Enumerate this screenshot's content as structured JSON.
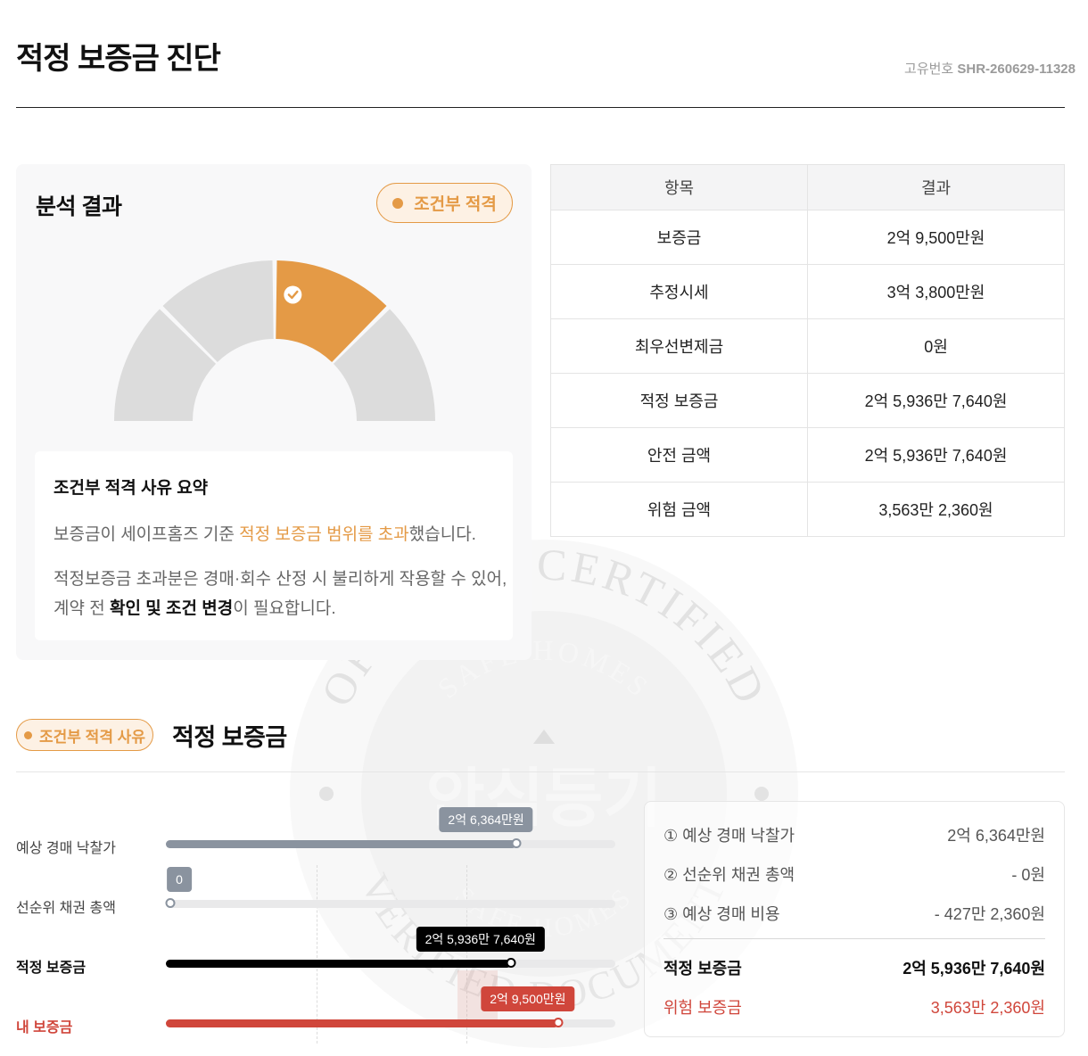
{
  "header": {
    "title": "적정 보증금 진단",
    "id_label": "고유번호",
    "id_value": "SHR-260629-11328"
  },
  "result": {
    "title": "분석 결과",
    "status": "조건부 적격",
    "gauge": {
      "segments": 4,
      "active_segment": 3,
      "active_color": "#E49A46",
      "inactive_color": "#DCDCDC"
    },
    "summary": {
      "title": "조건부 적격 사유 요약",
      "line1_a": "보증금이 세이프홈즈 기준 ",
      "line1_hl": "적정 보증금 범위를 초과",
      "line1_b": "했습니다.",
      "line2": "적정보증금 초과분은 경매·회수 산정 시 불리하게 작용할 수 있어,",
      "line3_a": "계약 전 ",
      "line3_strong": "확인 및 조건 변경",
      "line3_b": "이 필요합니다."
    }
  },
  "table": {
    "headers": [
      "항목",
      "결과"
    ],
    "rows": [
      [
        "보증금",
        "2억 9,500만원"
      ],
      [
        "추정시세",
        "3억 3,800만원"
      ],
      [
        "최우선변제금",
        "0원"
      ],
      [
        "적정 보증금",
        "2억 5,936만 7,640원"
      ],
      [
        "안전 금액",
        "2억 5,936만 7,640원"
      ],
      [
        "위험 금액",
        "3,563만 2,360원"
      ]
    ]
  },
  "section2": {
    "badge": "조건부 적격 사유",
    "title": "적정 보증금"
  },
  "bars": {
    "scale_max": 33800,
    "unit": "만원",
    "items": [
      {
        "label": "예상 경매 낙찰가",
        "tooltip": "2억 6,364만원",
        "value": 26364,
        "color": "#8A939F"
      },
      {
        "label": "선순위 채권 총액",
        "tooltip": "0",
        "value": 0,
        "color": "#8A939F"
      },
      {
        "label": "적정 보증금",
        "tooltip": "2억 5,936만 7,640원",
        "value": 25936.764,
        "color": "#000000"
      },
      {
        "label": "내 보증금",
        "tooltip": "2억 9,500만원",
        "value": 29500,
        "color": "#D0463B"
      }
    ]
  },
  "calc": {
    "rows": [
      {
        "label": "① 예상 경매 낙찰가",
        "value": "2억 6,364만원"
      },
      {
        "label": "② 선순위 채권 총액",
        "value": "- 0원"
      },
      {
        "label": "③ 예상 경매 비용",
        "value": "- 427만 2,360원"
      }
    ],
    "total_label": "적정 보증금",
    "total_value": "2억 5,936만 7,640원",
    "danger_label": "위험 보증금",
    "danger_value": "3,563만 2,360원"
  },
  "watermark": {
    "outer_text": "OFFICIAL CERTIFIED",
    "outer_text_bottom": "VERIFIED DOCUMENT",
    "inner_text": "SAFE HOMES",
    "center_text": "안심등기"
  },
  "colors": {
    "accent": "#E49A46",
    "danger": "#D0463B",
    "text": "#111111",
    "muted": "#666666"
  }
}
